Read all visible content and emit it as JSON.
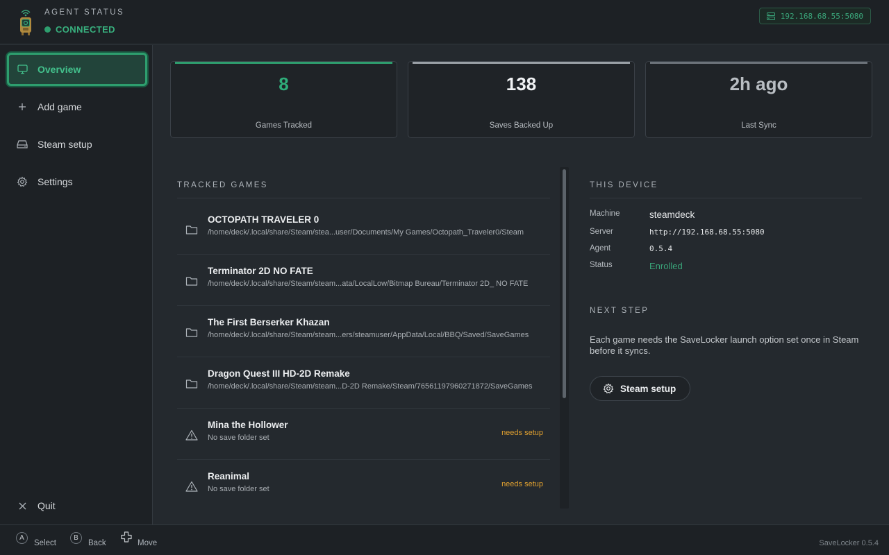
{
  "header": {
    "title": "AGENT STATUS",
    "status": "CONNECTED",
    "server_badge": "192.168.68.55:5080"
  },
  "sidebar": {
    "items": [
      {
        "label": "Overview",
        "icon": "monitor-icon",
        "active": true
      },
      {
        "label": "Add game",
        "icon": "plus-icon"
      },
      {
        "label": "Steam setup",
        "icon": "drive-icon"
      },
      {
        "label": "Settings",
        "icon": "gear-icon"
      }
    ],
    "quit_label": "Quit"
  },
  "stats": [
    {
      "value": "8",
      "label": "Games Tracked",
      "accent": "#2e9e6e"
    },
    {
      "value": "138",
      "label": "Saves Backed Up",
      "accent": "#9aa0a6"
    },
    {
      "value": "2h ago",
      "label": "Last Sync",
      "accent": "#6c737a"
    }
  ],
  "tracked_games": {
    "title": "TRACKED GAMES",
    "games": [
      {
        "name": "OCTOPATH TRAVELER 0",
        "path": "/home/deck/.local/share/Steam/stea...user/Documents/My Games/Octopath_Traveler0/Steam",
        "icon": "folder-icon",
        "badge": ""
      },
      {
        "name": "Terminator 2D NO FATE",
        "path": "/home/deck/.local/share/Steam/steam...ata/LocalLow/Bitmap Bureau/Terminator 2D_ NO FATE",
        "icon": "folder-icon",
        "badge": ""
      },
      {
        "name": "The First Berserker Khazan",
        "path": "/home/deck/.local/share/Steam/steam...ers/steamuser/AppData/Local/BBQ/Saved/SaveGames",
        "icon": "folder-icon",
        "badge": ""
      },
      {
        "name": "Dragon Quest III HD-2D Remake",
        "path": "/home/deck/.local/share/Steam/steam...D-2D Remake/Steam/76561197960271872/SaveGames",
        "icon": "folder-icon",
        "badge": ""
      },
      {
        "name": "Mina the Hollower",
        "path": "No save folder set",
        "icon": "warning-icon",
        "badge": "needs setup"
      },
      {
        "name": "Reanimal",
        "path": "No save folder set",
        "icon": "warning-icon",
        "badge": "needs setup"
      }
    ]
  },
  "device": {
    "title": "THIS DEVICE",
    "rows": [
      {
        "key": "Machine",
        "value": "steamdeck"
      },
      {
        "key": "Server",
        "value": "http://192.168.68.55:5080"
      },
      {
        "key": "Agent",
        "value": "0.5.4"
      },
      {
        "key": "Status",
        "value": "Enrolled"
      }
    ]
  },
  "next_step": {
    "title": "NEXT STEP",
    "text": "Each game needs the SaveLocker launch option set once in Steam before it syncs.",
    "button_label": "Steam setup"
  },
  "footer": {
    "hints": [
      {
        "key": "A",
        "label": "Select"
      },
      {
        "key": "B",
        "label": "Back"
      },
      {
        "key": "dpad",
        "label": "Move"
      }
    ],
    "version": "SaveLocker 0.5.4"
  },
  "colors": {
    "accent": "#2e9e6e",
    "warning": "#e0a030",
    "background": "#24292e",
    "panel": "#1d2125"
  }
}
